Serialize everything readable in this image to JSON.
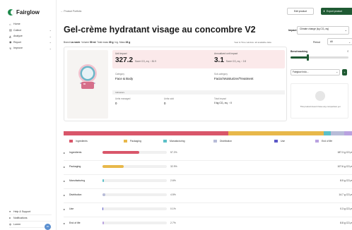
{
  "app": {
    "name": "Fairglow"
  },
  "sidebar": {
    "items": [
      {
        "label": "Home",
        "icon": "home-icon"
      },
      {
        "label": "Collect",
        "icon": "collect-icon"
      },
      {
        "label": "Analyze",
        "icon": "analyze-icon"
      },
      {
        "label": "Report",
        "icon": "report-icon"
      },
      {
        "label": "Improve",
        "icon": "improve-icon"
      }
    ],
    "bottom": [
      {
        "label": "Help & Support",
        "icon": "help-icon"
      },
      {
        "label": "Notifications",
        "icon": "bell-icon"
      },
      {
        "label": "Lorem",
        "icon": "user-icon"
      }
    ],
    "avatar_initials": "JD"
  },
  "header": {
    "breadcrumb": "← Product Portfolio",
    "edit_label": "Edit product",
    "export_label": "Export product",
    "colors": {
      "primary": "#1f5a33"
    }
  },
  "product": {
    "title": "Gel-crème hydratant visage au concombre V2",
    "impact_label": "Impact",
    "impact_value": "Climate change (kg CO₂ eq)",
    "brand_label": "Brand",
    "brand": "La rosée",
    "volume_label": "Volume",
    "volume": "50 ml",
    "total_mass_label": "Total mass",
    "total_mass": "30 g",
    "ing_mass_label": "Ing. Mass",
    "ing_mass": "33 g",
    "period_note": "Year & Time window: all available data",
    "period_label": "Period",
    "period_value": "All"
  },
  "stats": {
    "unit_impact_label": "Unit impact",
    "unit_impact_value": "327.2",
    "unit_impact_unit": "Score CO₂ eq. ↑ 81.9",
    "annual_label": "Annualized unit impact",
    "annual_value": "3.1",
    "annual_unit": "Score CO₂ eq. ↑ 2.8"
  },
  "details": {
    "category_label": "Category",
    "category": "Face & Body",
    "subcategory_label": "Sub-category",
    "subcategory": "Facial Moisturizer/Treatment",
    "indicators_label": "Indicators",
    "units_managed_label": "Units managed",
    "units_managed": "0",
    "units_sold_label": "Units sold",
    "units_sold": "0",
    "total_impact_label": "Total impact",
    "total_impact": "0 kg CO₂ eq. ↑ 0"
  },
  "benchmarking": {
    "title": "Benchmarking",
    "slider_fraction": 0.3,
    "select_value": "Fairglow Indu...",
    "empty_text": "This product doesn't have any comparison yet"
  },
  "legend": [
    {
      "label": "Ingredients",
      "color": "#d9566a"
    },
    {
      "label": "Packaging",
      "color": "#e8b84a"
    },
    {
      "label": "Manufacturing",
      "color": "#5bc0c8"
    },
    {
      "label": "Distribution",
      "color": "#b8bcd8"
    },
    {
      "label": "Use",
      "color": "#5b58c8"
    },
    {
      "label": "End of life",
      "color": "#b9a2e0"
    }
  ],
  "chart_data": {
    "type": "bar",
    "categories": [
      "Ingredients",
      "Packaging",
      "Manufacturing",
      "Distribution",
      "Use",
      "End of life"
    ],
    "values": [
      57.2,
      32.9,
      2.6,
      4.5,
      0.1,
      2.7
    ],
    "amounts": [
      "187.3 g CO₂e",
      "107.6 g CO₂e",
      "8.5 g CO₂e",
      "14.7 g CO₂e",
      "0.3 g CO₂e",
      "8.8 g CO₂e"
    ],
    "percent_labels": [
      "57.2%",
      "32.9%",
      "2.6%",
      "4.5%",
      "0.1%",
      "2.7%"
    ],
    "colors": [
      "#d9566a",
      "#e8b84a",
      "#5bc0c8",
      "#b8bcd8",
      "#5b58c8",
      "#b9a2e0"
    ]
  }
}
